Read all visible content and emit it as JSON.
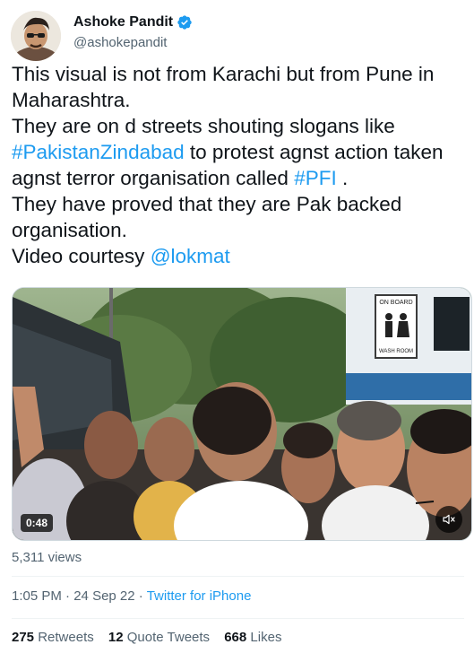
{
  "author": {
    "display_name": "Ashoke Pandit",
    "handle": "@ashokepandit",
    "verified": true,
    "avatar_icon": "profile-photo"
  },
  "tweet": {
    "lines": [
      [
        {
          "text": "This visual is not from Karachi but from Pune in"
        }
      ],
      [
        {
          "text": "Maharashtra."
        }
      ],
      [
        {
          "text": "They are on d streets shouting slogans like"
        }
      ],
      [
        {
          "text": "#PakistanZindabad",
          "link": true
        },
        {
          "text": " to protest agnst action taken"
        }
      ],
      [
        {
          "text": "agnst terror organisation called "
        },
        {
          "text": "#PFI",
          "link": true
        },
        {
          "text": " ."
        }
      ],
      [
        {
          "text": "They have proved that they are Pak backed"
        }
      ],
      [
        {
          "text": "organisation."
        }
      ],
      [
        {
          "text": "Video courtesy "
        },
        {
          "text": "@lokmat",
          "link": true
        }
      ]
    ]
  },
  "media": {
    "duration": "0:48",
    "mute_icon": "speaker-muted-icon",
    "bus_sign_top": "ON BOARD",
    "bus_sign_bottom": "WASH ROOM"
  },
  "views": "5,311 views",
  "meta": {
    "time": "1:05 PM",
    "separator": " · ",
    "date": "24 Sep 22",
    "source": "Twitter for iPhone"
  },
  "stats": {
    "retweets_count": "275",
    "retweets_label": "Retweets",
    "quote_count": "12",
    "quote_label": "Quote Tweets",
    "likes_count": "668",
    "likes_label": "Likes"
  },
  "colors": {
    "accent": "#1d9bf0",
    "secondary_text": "#536471",
    "primary_text": "#0f1419"
  }
}
